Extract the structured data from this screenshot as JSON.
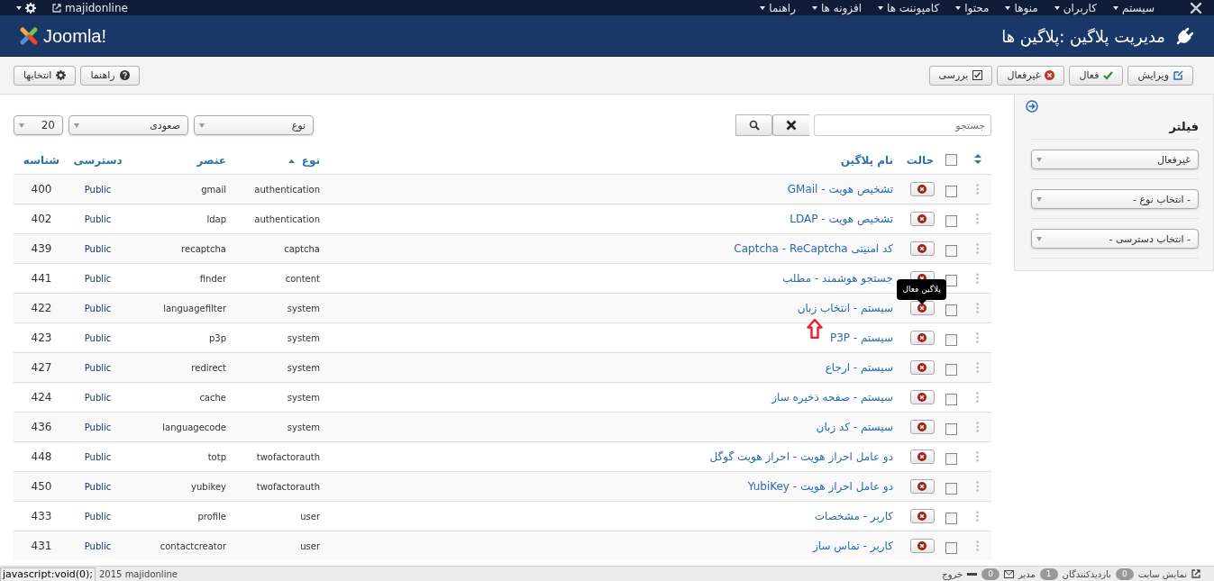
{
  "top_menu": {
    "items": [
      "سیستم",
      "کاربران",
      "منوها",
      "محتوا",
      "کامپوننت ها",
      "افزونه ها",
      "راهنما"
    ],
    "site_link": "majidonline"
  },
  "header": {
    "logo_text": "Joomla!",
    "title": "مدیریت پلاگین :پلاگین ها"
  },
  "toolbar": {
    "actions": [
      {
        "label": "ویرایش",
        "kind": "edit"
      },
      {
        "label": "فعال",
        "kind": "enable"
      },
      {
        "label": "غیرفعال",
        "kind": "disable"
      },
      {
        "label": "بررسی",
        "kind": "checkin"
      }
    ],
    "side_actions": [
      {
        "label": "راهنما",
        "kind": "help"
      },
      {
        "label": "انتخابها",
        "kind": "options"
      }
    ]
  },
  "sidebar": {
    "title": "فیلتر",
    "filters": [
      "غیرفعال",
      "- انتخاب نوع -",
      "- انتخاب دسترسی -"
    ]
  },
  "search": {
    "placeholder": "جستجو"
  },
  "list_controls": {
    "sort_field": "نوع",
    "direction": "صعودی",
    "limit": "20"
  },
  "table": {
    "header_checked": false,
    "columns": [
      {
        "label": "حالت",
        "sorted": false
      },
      {
        "label": "نام پلاگین",
        "sorted": false
      },
      {
        "label": "نوع",
        "sorted": true
      },
      {
        "label": "عنصر",
        "sorted": false
      },
      {
        "label": "دسترسی",
        "sorted": false
      },
      {
        "label": "شناسه",
        "sorted": false
      }
    ],
    "rows": [
      {
        "checked": false,
        "enabled": false,
        "name": "تشخیص هویت - GMail",
        "type": "authentication",
        "element": "gmail",
        "access": "Public",
        "id": "400"
      },
      {
        "checked": false,
        "enabled": false,
        "name": "تشخیص هویت - LDAP",
        "type": "authentication",
        "element": "ldap",
        "access": "Public",
        "id": "402"
      },
      {
        "checked": false,
        "enabled": false,
        "name": "کد امنیتی Captcha - ReCaptcha",
        "type": "captcha",
        "element": "recaptcha",
        "access": "Public",
        "id": "439"
      },
      {
        "checked": false,
        "enabled": false,
        "name": "جستجو هوشمند - مطلب",
        "type": "content",
        "element": "finder",
        "access": "Public",
        "id": "441"
      },
      {
        "checked": false,
        "enabled": false,
        "name": "سیستم - انتخاب زبان",
        "type": "system",
        "element": "languagefilter",
        "access": "Public",
        "id": "422"
      },
      {
        "checked": false,
        "enabled": false,
        "name": "سیستم - P3P",
        "type": "system",
        "element": "p3p",
        "access": "Public",
        "id": "423"
      },
      {
        "checked": false,
        "enabled": false,
        "name": "سیستم - ارجاع",
        "type": "system",
        "element": "redirect",
        "access": "Public",
        "id": "427"
      },
      {
        "checked": false,
        "enabled": false,
        "name": "سیستم - صفحه ذخیره ساز",
        "type": "system",
        "element": "cache",
        "access": "Public",
        "id": "424"
      },
      {
        "checked": false,
        "enabled": false,
        "name": "سیستم - کد زبان",
        "type": "system",
        "element": "languagecode",
        "access": "Public",
        "id": "436"
      },
      {
        "checked": false,
        "enabled": false,
        "name": "دو عامل احراز هویت - احراز هویت گوگل",
        "type": "twofactorauth",
        "element": "totp",
        "access": "Public",
        "id": "448"
      },
      {
        "checked": false,
        "enabled": false,
        "name": "دو عامل احراز هویت - YubiKey",
        "type": "twofactorauth",
        "element": "yubikey",
        "access": "Public",
        "id": "450"
      },
      {
        "checked": false,
        "enabled": false,
        "name": "کاربر - مشخصات",
        "type": "user",
        "element": "profile",
        "access": "Public",
        "id": "433"
      },
      {
        "checked": false,
        "enabled": false,
        "name": "کاربر - تماس ساز",
        "type": "user",
        "element": "contactcreator",
        "access": "Public",
        "id": "431"
      }
    ]
  },
  "tooltip": {
    "text": "پلاگین فعال"
  },
  "status_bar": {
    "view_site": "نمایش سایت",
    "visitors_count": "0",
    "visitors": "بازدیدکنندگان",
    "admins_count": "1",
    "admins": "مدیر",
    "messages_count": "0",
    "logout": "خروج",
    "copyright": "2015 majidonline"
  },
  "browser_status": "javascript:void(0);"
}
